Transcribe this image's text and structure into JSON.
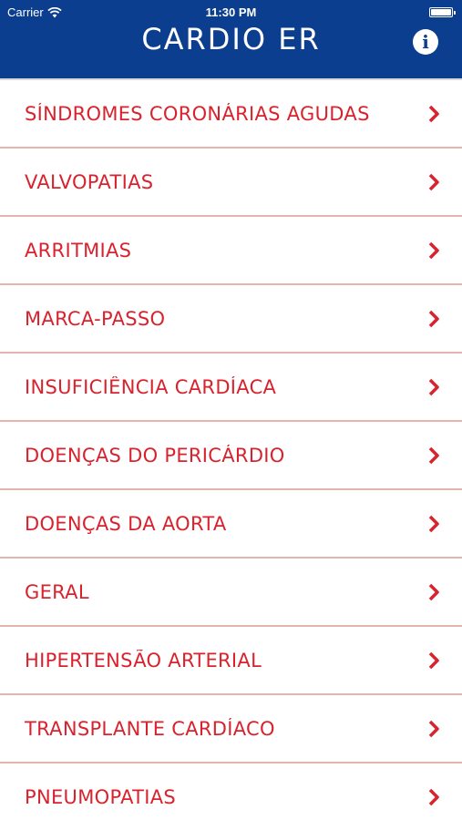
{
  "status_bar": {
    "carrier": "Carrier",
    "time": "11:30 PM"
  },
  "header": {
    "title": "CARDIO ER",
    "info_icon": "info-icon",
    "info_glyph": "i"
  },
  "colors": {
    "header_bg": "#0b3e8e",
    "accent": "#d8232e",
    "divider": "#e6b3ad"
  },
  "menu": {
    "items": [
      {
        "label": "SÍNDROMES CORONÁRIAS AGUDAS"
      },
      {
        "label": "VALVOPATIAS"
      },
      {
        "label": "ARRITMIAS"
      },
      {
        "label": "MARCA-PASSO"
      },
      {
        "label": "INSUFICIÊNCIA CARDÍACA"
      },
      {
        "label": "DOENÇAS DO PERICÁRDIO"
      },
      {
        "label": "DOENÇAS DA AORTA"
      },
      {
        "label": "GERAL"
      },
      {
        "label": "HIPERTENSÃO ARTERIAL"
      },
      {
        "label": "TRANSPLANTE CARDÍACO"
      },
      {
        "label": "PNEUMOPATIAS"
      }
    ]
  }
}
